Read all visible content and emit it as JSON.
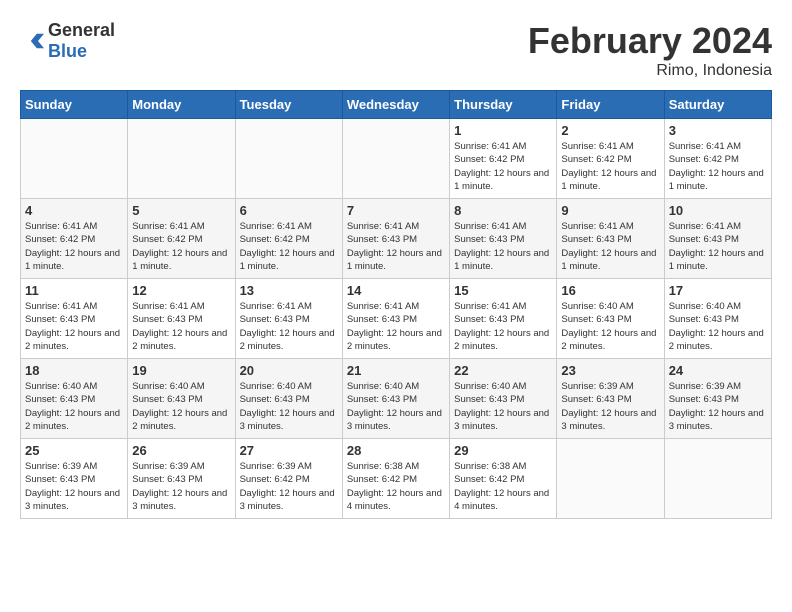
{
  "header": {
    "logo_general": "General",
    "logo_blue": "Blue",
    "title": "February 2024",
    "subtitle": "Rimo, Indonesia"
  },
  "days_of_week": [
    "Sunday",
    "Monday",
    "Tuesday",
    "Wednesday",
    "Thursday",
    "Friday",
    "Saturday"
  ],
  "weeks": [
    [
      {
        "day": "",
        "info": ""
      },
      {
        "day": "",
        "info": ""
      },
      {
        "day": "",
        "info": ""
      },
      {
        "day": "",
        "info": ""
      },
      {
        "day": "1",
        "info": "Sunrise: 6:41 AM\nSunset: 6:42 PM\nDaylight: 12 hours\nand 1 minute."
      },
      {
        "day": "2",
        "info": "Sunrise: 6:41 AM\nSunset: 6:42 PM\nDaylight: 12 hours\nand 1 minute."
      },
      {
        "day": "3",
        "info": "Sunrise: 6:41 AM\nSunset: 6:42 PM\nDaylight: 12 hours\nand 1 minute."
      }
    ],
    [
      {
        "day": "4",
        "info": "Sunrise: 6:41 AM\nSunset: 6:42 PM\nDaylight: 12 hours\nand 1 minute."
      },
      {
        "day": "5",
        "info": "Sunrise: 6:41 AM\nSunset: 6:42 PM\nDaylight: 12 hours\nand 1 minute."
      },
      {
        "day": "6",
        "info": "Sunrise: 6:41 AM\nSunset: 6:42 PM\nDaylight: 12 hours\nand 1 minute."
      },
      {
        "day": "7",
        "info": "Sunrise: 6:41 AM\nSunset: 6:43 PM\nDaylight: 12 hours\nand 1 minute."
      },
      {
        "day": "8",
        "info": "Sunrise: 6:41 AM\nSunset: 6:43 PM\nDaylight: 12 hours\nand 1 minute."
      },
      {
        "day": "9",
        "info": "Sunrise: 6:41 AM\nSunset: 6:43 PM\nDaylight: 12 hours\nand 1 minute."
      },
      {
        "day": "10",
        "info": "Sunrise: 6:41 AM\nSunset: 6:43 PM\nDaylight: 12 hours\nand 1 minute."
      }
    ],
    [
      {
        "day": "11",
        "info": "Sunrise: 6:41 AM\nSunset: 6:43 PM\nDaylight: 12 hours\nand 2 minutes."
      },
      {
        "day": "12",
        "info": "Sunrise: 6:41 AM\nSunset: 6:43 PM\nDaylight: 12 hours\nand 2 minutes."
      },
      {
        "day": "13",
        "info": "Sunrise: 6:41 AM\nSunset: 6:43 PM\nDaylight: 12 hours\nand 2 minutes."
      },
      {
        "day": "14",
        "info": "Sunrise: 6:41 AM\nSunset: 6:43 PM\nDaylight: 12 hours\nand 2 minutes."
      },
      {
        "day": "15",
        "info": "Sunrise: 6:41 AM\nSunset: 6:43 PM\nDaylight: 12 hours\nand 2 minutes."
      },
      {
        "day": "16",
        "info": "Sunrise: 6:40 AM\nSunset: 6:43 PM\nDaylight: 12 hours\nand 2 minutes."
      },
      {
        "day": "17",
        "info": "Sunrise: 6:40 AM\nSunset: 6:43 PM\nDaylight: 12 hours\nand 2 minutes."
      }
    ],
    [
      {
        "day": "18",
        "info": "Sunrise: 6:40 AM\nSunset: 6:43 PM\nDaylight: 12 hours\nand 2 minutes."
      },
      {
        "day": "19",
        "info": "Sunrise: 6:40 AM\nSunset: 6:43 PM\nDaylight: 12 hours\nand 2 minutes."
      },
      {
        "day": "20",
        "info": "Sunrise: 6:40 AM\nSunset: 6:43 PM\nDaylight: 12 hours\nand 3 minutes."
      },
      {
        "day": "21",
        "info": "Sunrise: 6:40 AM\nSunset: 6:43 PM\nDaylight: 12 hours\nand 3 minutes."
      },
      {
        "day": "22",
        "info": "Sunrise: 6:40 AM\nSunset: 6:43 PM\nDaylight: 12 hours\nand 3 minutes."
      },
      {
        "day": "23",
        "info": "Sunrise: 6:39 AM\nSunset: 6:43 PM\nDaylight: 12 hours\nand 3 minutes."
      },
      {
        "day": "24",
        "info": "Sunrise: 6:39 AM\nSunset: 6:43 PM\nDaylight: 12 hours\nand 3 minutes."
      }
    ],
    [
      {
        "day": "25",
        "info": "Sunrise: 6:39 AM\nSunset: 6:43 PM\nDaylight: 12 hours\nand 3 minutes."
      },
      {
        "day": "26",
        "info": "Sunrise: 6:39 AM\nSunset: 6:43 PM\nDaylight: 12 hours\nand 3 minutes."
      },
      {
        "day": "27",
        "info": "Sunrise: 6:39 AM\nSunset: 6:42 PM\nDaylight: 12 hours\nand 3 minutes."
      },
      {
        "day": "28",
        "info": "Sunrise: 6:38 AM\nSunset: 6:42 PM\nDaylight: 12 hours\nand 4 minutes."
      },
      {
        "day": "29",
        "info": "Sunrise: 6:38 AM\nSunset: 6:42 PM\nDaylight: 12 hours\nand 4 minutes."
      },
      {
        "day": "",
        "info": ""
      },
      {
        "day": "",
        "info": ""
      }
    ]
  ]
}
